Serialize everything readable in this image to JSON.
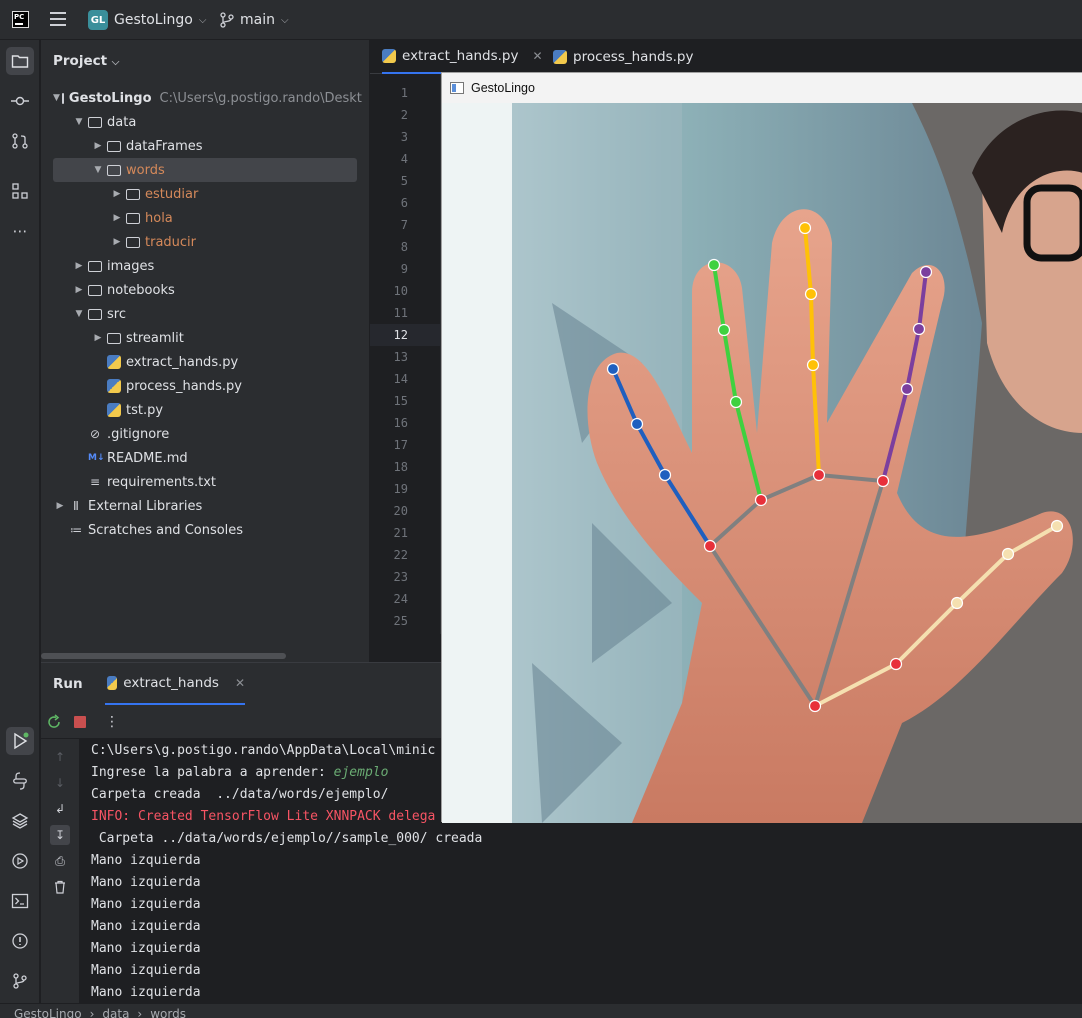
{
  "titlebar": {
    "logo": "PC",
    "project_badge": "GL",
    "project_name": "GestoLingo",
    "branch": "main"
  },
  "left_toolbar": [
    "folder-icon",
    "commit-icon",
    "pull-requests-icon",
    "structure-icon",
    "more-icon"
  ],
  "project_panel": {
    "header": "Project",
    "root": {
      "name": "GestoLingo",
      "path": "C:\\Users\\g.postigo.rando\\Deskt"
    },
    "items": [
      {
        "label": "data",
        "kind": "folder",
        "depth": 1,
        "expanded": true
      },
      {
        "label": "dataFrames",
        "kind": "folder",
        "depth": 2
      },
      {
        "label": "words",
        "kind": "folder",
        "depth": 2,
        "expanded": true,
        "selected": true,
        "excluded": true
      },
      {
        "label": "estudiar",
        "kind": "folder",
        "depth": 3,
        "excluded": true
      },
      {
        "label": "hola",
        "kind": "folder",
        "depth": 3,
        "excluded": true
      },
      {
        "label": "traducir",
        "kind": "folder",
        "depth": 3,
        "excluded": true
      },
      {
        "label": "images",
        "kind": "folder",
        "depth": 1
      },
      {
        "label": "notebooks",
        "kind": "folder",
        "depth": 1
      },
      {
        "label": "src",
        "kind": "folder",
        "depth": 1,
        "expanded": true
      },
      {
        "label": "streamlit",
        "kind": "folder",
        "depth": 2
      },
      {
        "label": "extract_hands.py",
        "kind": "python",
        "depth": 2
      },
      {
        "label": "process_hands.py",
        "kind": "python",
        "depth": 2
      },
      {
        "label": "tst.py",
        "kind": "python",
        "depth": 2
      },
      {
        "label": ".gitignore",
        "kind": "ignore",
        "depth": 1
      },
      {
        "label": "README.md",
        "kind": "markdown",
        "depth": 1
      },
      {
        "label": "requirements.txt",
        "kind": "text",
        "depth": 1
      },
      {
        "label": "External Libraries",
        "kind": "library",
        "depth": 0
      },
      {
        "label": "Scratches and Consoles",
        "kind": "scratch",
        "depth": 0
      }
    ]
  },
  "editor": {
    "tabs": [
      {
        "label": "extract_hands.py",
        "active": true
      },
      {
        "label": "process_hands.py",
        "active": false
      }
    ],
    "line_numbers": [
      "1",
      "2",
      "3",
      "4",
      "5",
      "6",
      "7",
      "8",
      "9",
      "10",
      "11",
      "12",
      "13",
      "14",
      "15",
      "16",
      "17",
      "18",
      "19",
      "20",
      "21",
      "22",
      "23",
      "24",
      "25"
    ],
    "current_line": "12"
  },
  "run_panel": {
    "title": "Run",
    "tab": "extract_hands",
    "console_lines": [
      {
        "text": "C:\\Users\\g.postigo.rando\\AppData\\Local\\minic",
        "style": "normal"
      },
      {
        "text": "Ingrese la palabra a aprender: ",
        "input": "ejemplo",
        "style": "prompt"
      },
      {
        "text": "Carpeta creada  ../data/words/ejemplo/",
        "style": "normal"
      },
      {
        "text": "INFO: Created TensorFlow Lite XNNPACK delega",
        "style": "error"
      },
      {
        "text": " Carpeta ../data/words/ejemplo//sample_000/ creada",
        "style": "normal"
      },
      {
        "text": "Mano izquierda",
        "style": "normal"
      },
      {
        "text": "Mano izquierda",
        "style": "normal"
      },
      {
        "text": "Mano izquierda",
        "style": "normal"
      },
      {
        "text": "Mano izquierda",
        "style": "normal"
      },
      {
        "text": "Mano izquierda",
        "style": "normal"
      },
      {
        "text": "Mano izquierda",
        "style": "normal"
      },
      {
        "text": "Mano izquierda",
        "style": "normal"
      }
    ]
  },
  "status_bar": {
    "breadcrumbs": [
      "GestoLingo",
      "data",
      "words"
    ]
  },
  "camera_window": {
    "title": "GestoLingo",
    "landmark_colors": {
      "joint": "#e8303a",
      "thumb": "#f5e0b0",
      "index": "#1f5fbf",
      "middle": "#3fd13f",
      "ring": "#ffc107",
      "pinky": "#7b3f9e",
      "palm": "#808080"
    }
  },
  "colors": {
    "accent": "#3574f0",
    "background": "#1e1f22",
    "panel": "#2b2d30",
    "excluded_folder": "#d5895a",
    "error_text": "#f75464",
    "input_text": "#6aab73"
  }
}
